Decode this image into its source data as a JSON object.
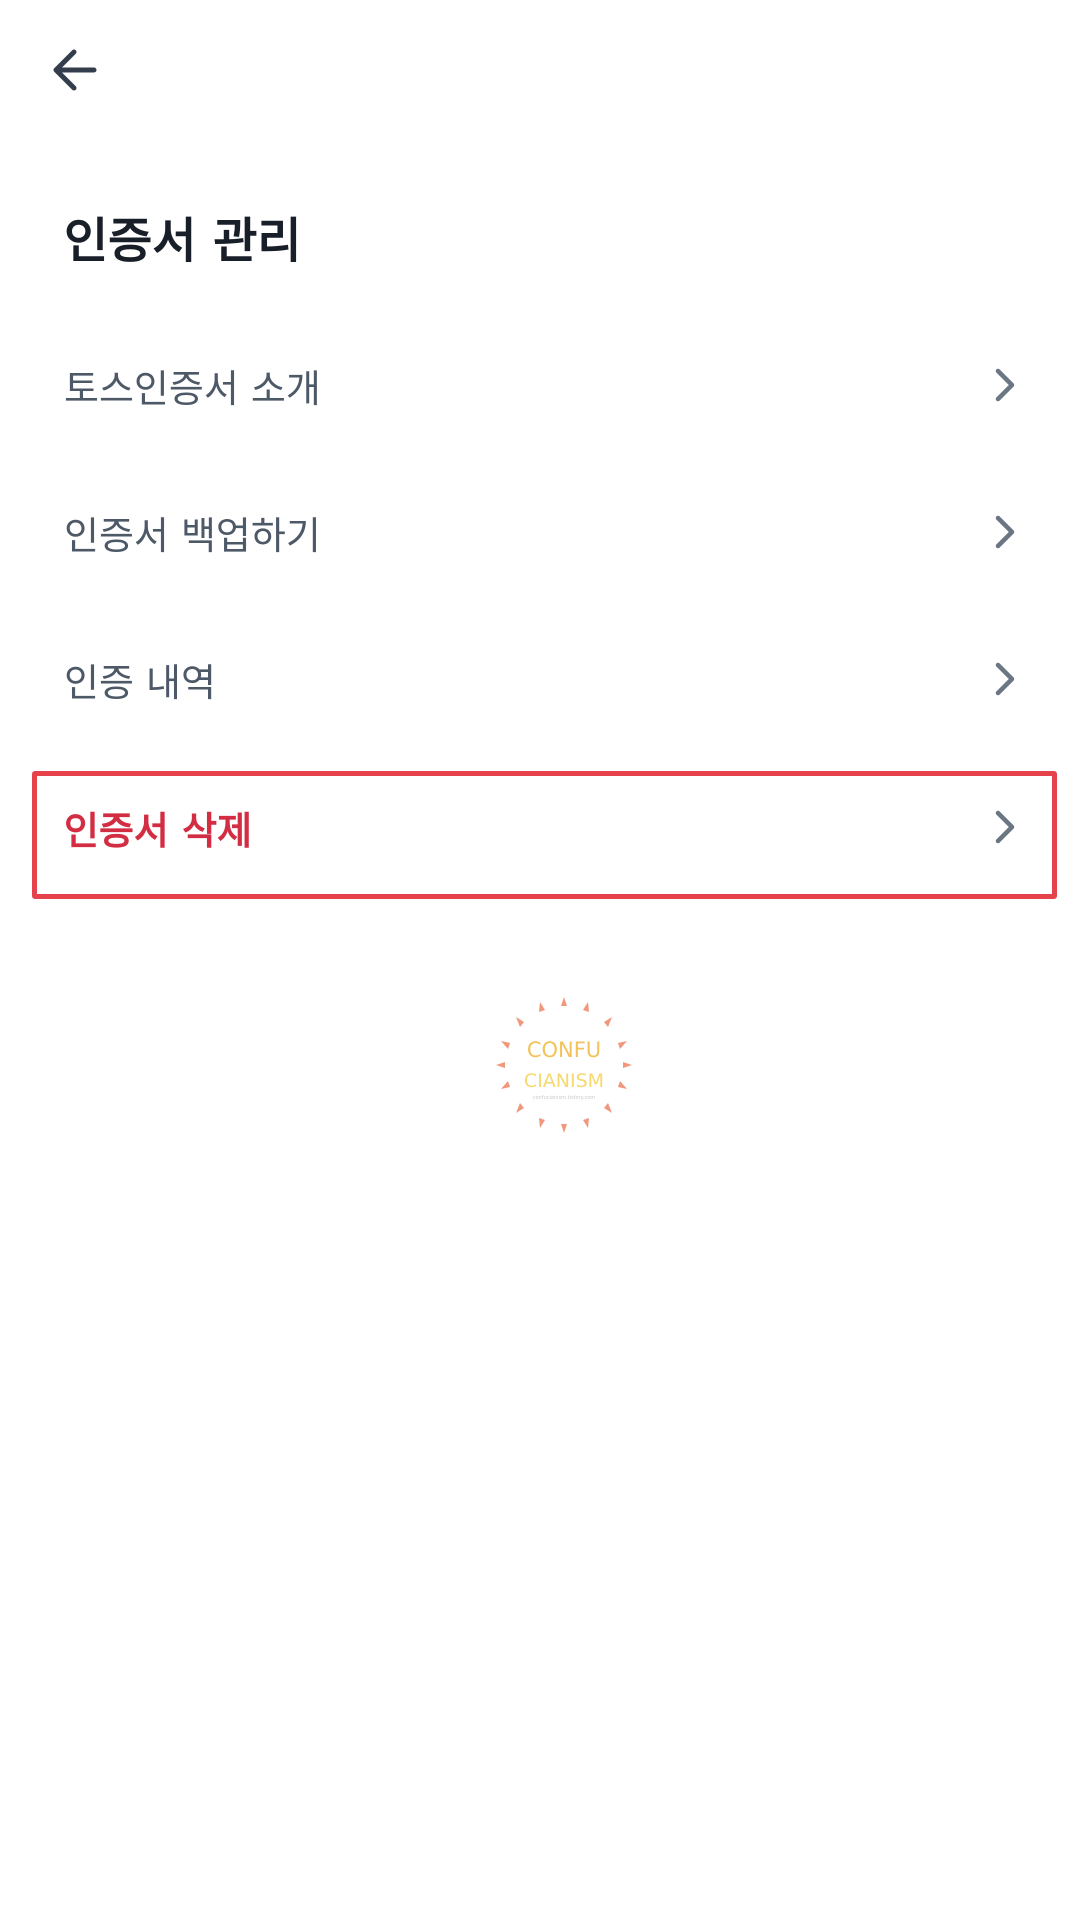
{
  "header": {
    "back_icon": "arrow-left-icon"
  },
  "page": {
    "title": "인증서 관리"
  },
  "menu": {
    "items": [
      {
        "label": "토스인증서 소개",
        "icon": "chevron-right-icon"
      },
      {
        "label": "인증서 백업하기",
        "icon": "chevron-right-icon"
      },
      {
        "label": "인증 내역",
        "icon": "chevron-right-icon"
      },
      {
        "label": "인증서 삭제",
        "icon": "chevron-right-icon",
        "color": "#d22d43",
        "highlighted": true
      }
    ]
  },
  "watermark": {
    "line1": "CONFU",
    "line2": "CIANISM",
    "line3": "confucianism.tistory.com"
  },
  "colors": {
    "title": "#191f28",
    "menu_text": "#4e5968",
    "danger": "#d22d43",
    "highlight_border": "#e5424b",
    "chevron": "#6b7684"
  }
}
